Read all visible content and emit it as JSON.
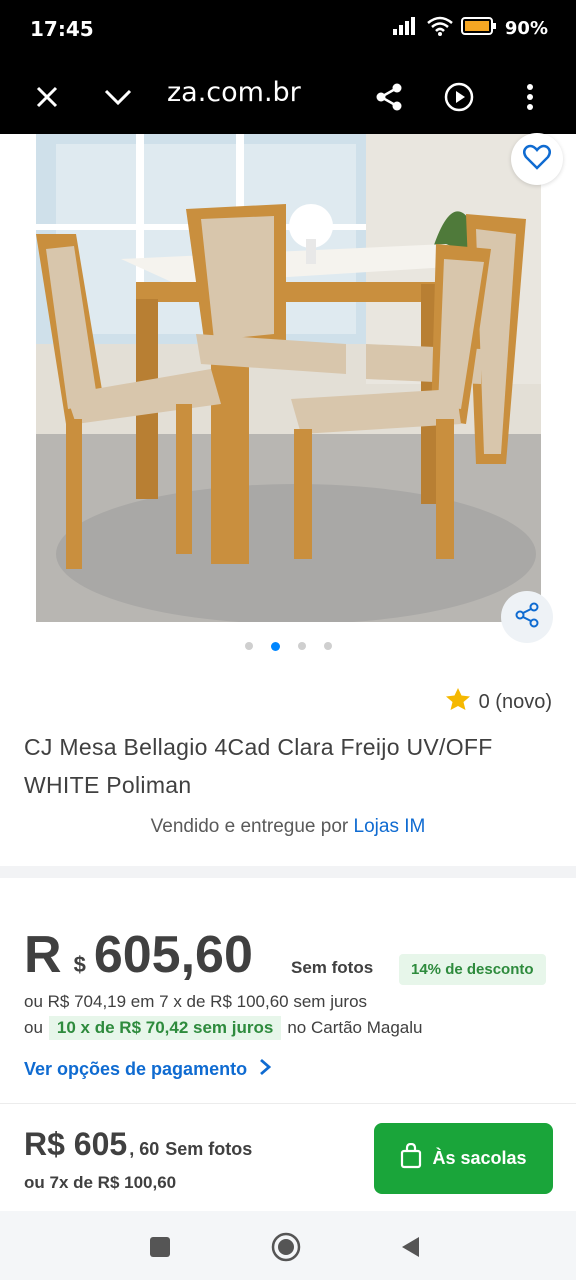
{
  "status": {
    "time": "17:45",
    "battery": "90%"
  },
  "browser": {
    "url": "za.com.br",
    "icons": [
      "close-icon",
      "chevron-down-icon",
      "share-icon",
      "play-circle-icon",
      "more-vert-icon"
    ]
  },
  "gallery": {
    "dot_count": 4,
    "active_index": 1
  },
  "product": {
    "rating": "0 (novo)",
    "title": "CJ Mesa Bellagio 4Cad Clara Freijo UV/OFF WHITE Poliman",
    "sold_by_prefix": "Vendido e entregue por",
    "store": "Lojas IM"
  },
  "price": {
    "symbol_r": "R",
    "symbol_cur": "$",
    "value": "605,60",
    "no_photo": "Sem fotos",
    "discount": "14% de desconto",
    "installments_full": "ou R$ 704,19 em 7 x de R$ 100,60 sem juros",
    "installments_prefix": "ou",
    "installments_highlight": "10 x de R$ 70,42 sem juros",
    "installments_suffix": "no Cartão Magalu",
    "payment_options": "Ver opções de pagamento"
  },
  "bottom": {
    "price_main": "R$ 605",
    "price_cents": ", 60",
    "no_photo": "Sem fotos",
    "installments": "ou 7x de R$ 100,60",
    "cart_label": "Às sacolas"
  },
  "colors": {
    "accent_blue": "#0f6bd1",
    "cart_green": "#1aa53a",
    "discount_bg": "#e7f6ea",
    "discount_text": "#2e8b3d"
  }
}
